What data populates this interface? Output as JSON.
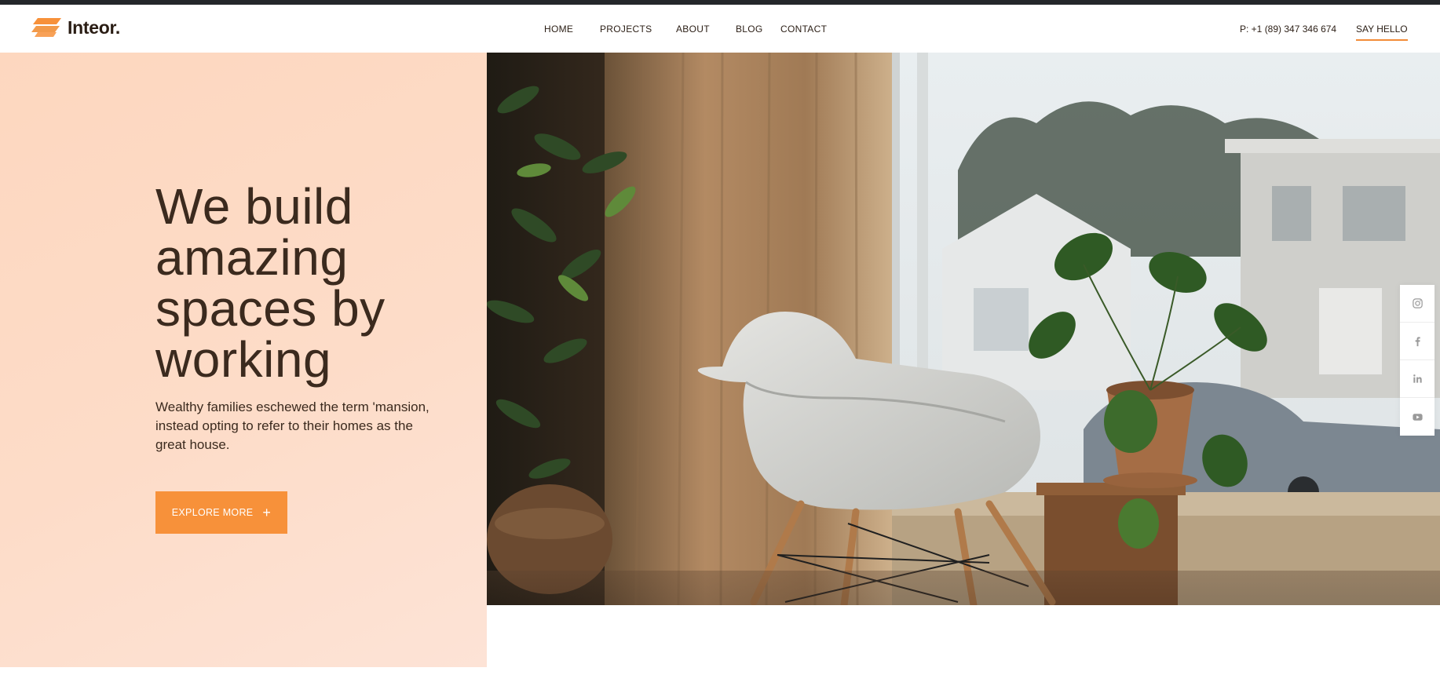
{
  "header": {
    "logo_text": "Inteor.",
    "nav": [
      "HOME",
      "PROJECTS",
      "ABOUT",
      "BLOG",
      "CONTACT"
    ],
    "phone": "P: +1 (89) 347 346 674",
    "cta": "SAY HELLO"
  },
  "hero": {
    "title": "We build amazing spaces by working",
    "subtitle": "Wealthy families eschewed the term 'mansion, instead opting to refer to their homes as the great house.",
    "button_label": "EXPLORE MORE",
    "button_icon": "plus-icon"
  },
  "social": [
    "instagram-icon",
    "facebook-icon",
    "linkedin-icon",
    "youtube-icon"
  ],
  "colors": {
    "accent": "#f7913a",
    "hero_bg": "#fdd9c4",
    "text_dark": "#3b2a1e"
  }
}
